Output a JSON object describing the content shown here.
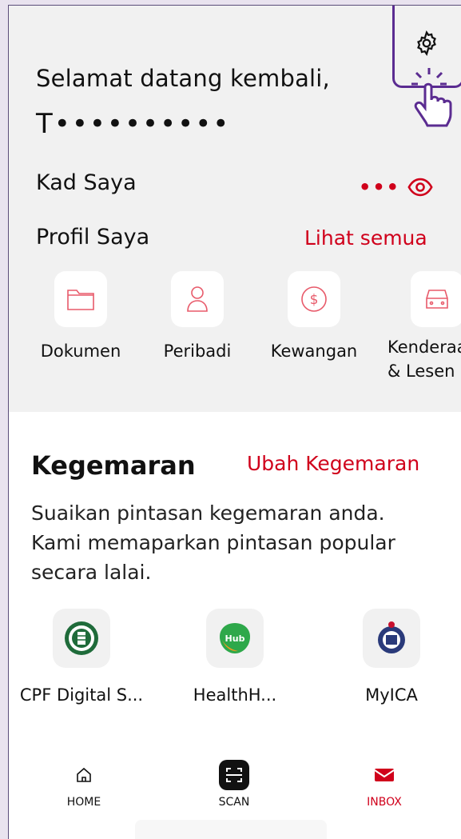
{
  "header": {
    "greeting": "Selamat datang kembali,",
    "masked_name": "T••••••••••"
  },
  "cards": {
    "title": "Kad Saya",
    "more": "•••"
  },
  "profile": {
    "title": "Profil Saya",
    "see_all": "Lihat semua",
    "items": [
      {
        "label": "Dokumen",
        "icon": "folder-icon"
      },
      {
        "label": "Peribadi",
        "icon": "person-icon"
      },
      {
        "label": "Kewangan",
        "icon": "dollar-icon"
      },
      {
        "label": "Kenderaan & Lesen M",
        "icon": "car-icon"
      }
    ]
  },
  "favourites": {
    "title": "Kegemaran",
    "edit": "Ubah Kegemaran",
    "description": "Suaikan pintasan kegemaran anda. Kami memaparkan pintasan popular secara lalai.",
    "apps": [
      {
        "label": "CPF Digital S...",
        "icon": "cpf-logo-icon"
      },
      {
        "label": "HealthH...",
        "icon": "healthhub-logo-icon"
      },
      {
        "label": "MyICA",
        "icon": "ica-logo-icon"
      }
    ]
  },
  "nav": {
    "home": "HOME",
    "scan": "SCAN",
    "inbox": "INBOX"
  },
  "colors": {
    "accent": "#d0001b",
    "highlight": "#5b2c91"
  }
}
